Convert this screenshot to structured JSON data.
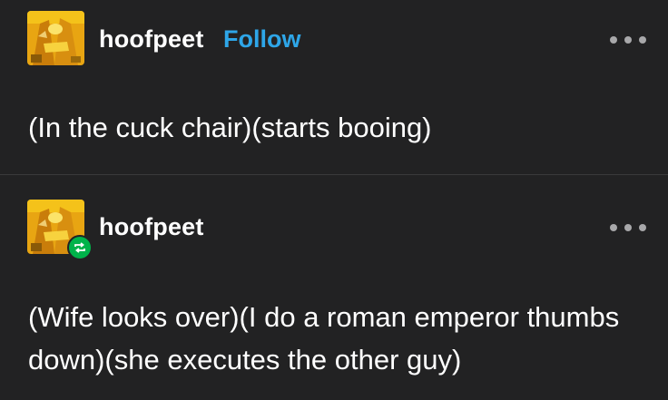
{
  "colors": {
    "background": "#222223",
    "text": "#ffffff",
    "follow_link": "#2ea6e8",
    "reblog_badge": "#00b34a",
    "more_dots": "#a8a8aa"
  },
  "posts": [
    {
      "username": "hoofpeet",
      "follow_label": "Follow",
      "avatar_icon": "golden-figure-avatar",
      "more_icon": "more-options-icon",
      "text": "(In the cuck chair)(starts booing)"
    },
    {
      "username": "hoofpeet",
      "avatar_icon": "golden-figure-avatar",
      "badge_icon": "reblog-icon",
      "more_icon": "more-options-icon",
      "text": "(Wife looks over)(I do a roman emperor thumbs down)(she executes the other guy)"
    }
  ]
}
